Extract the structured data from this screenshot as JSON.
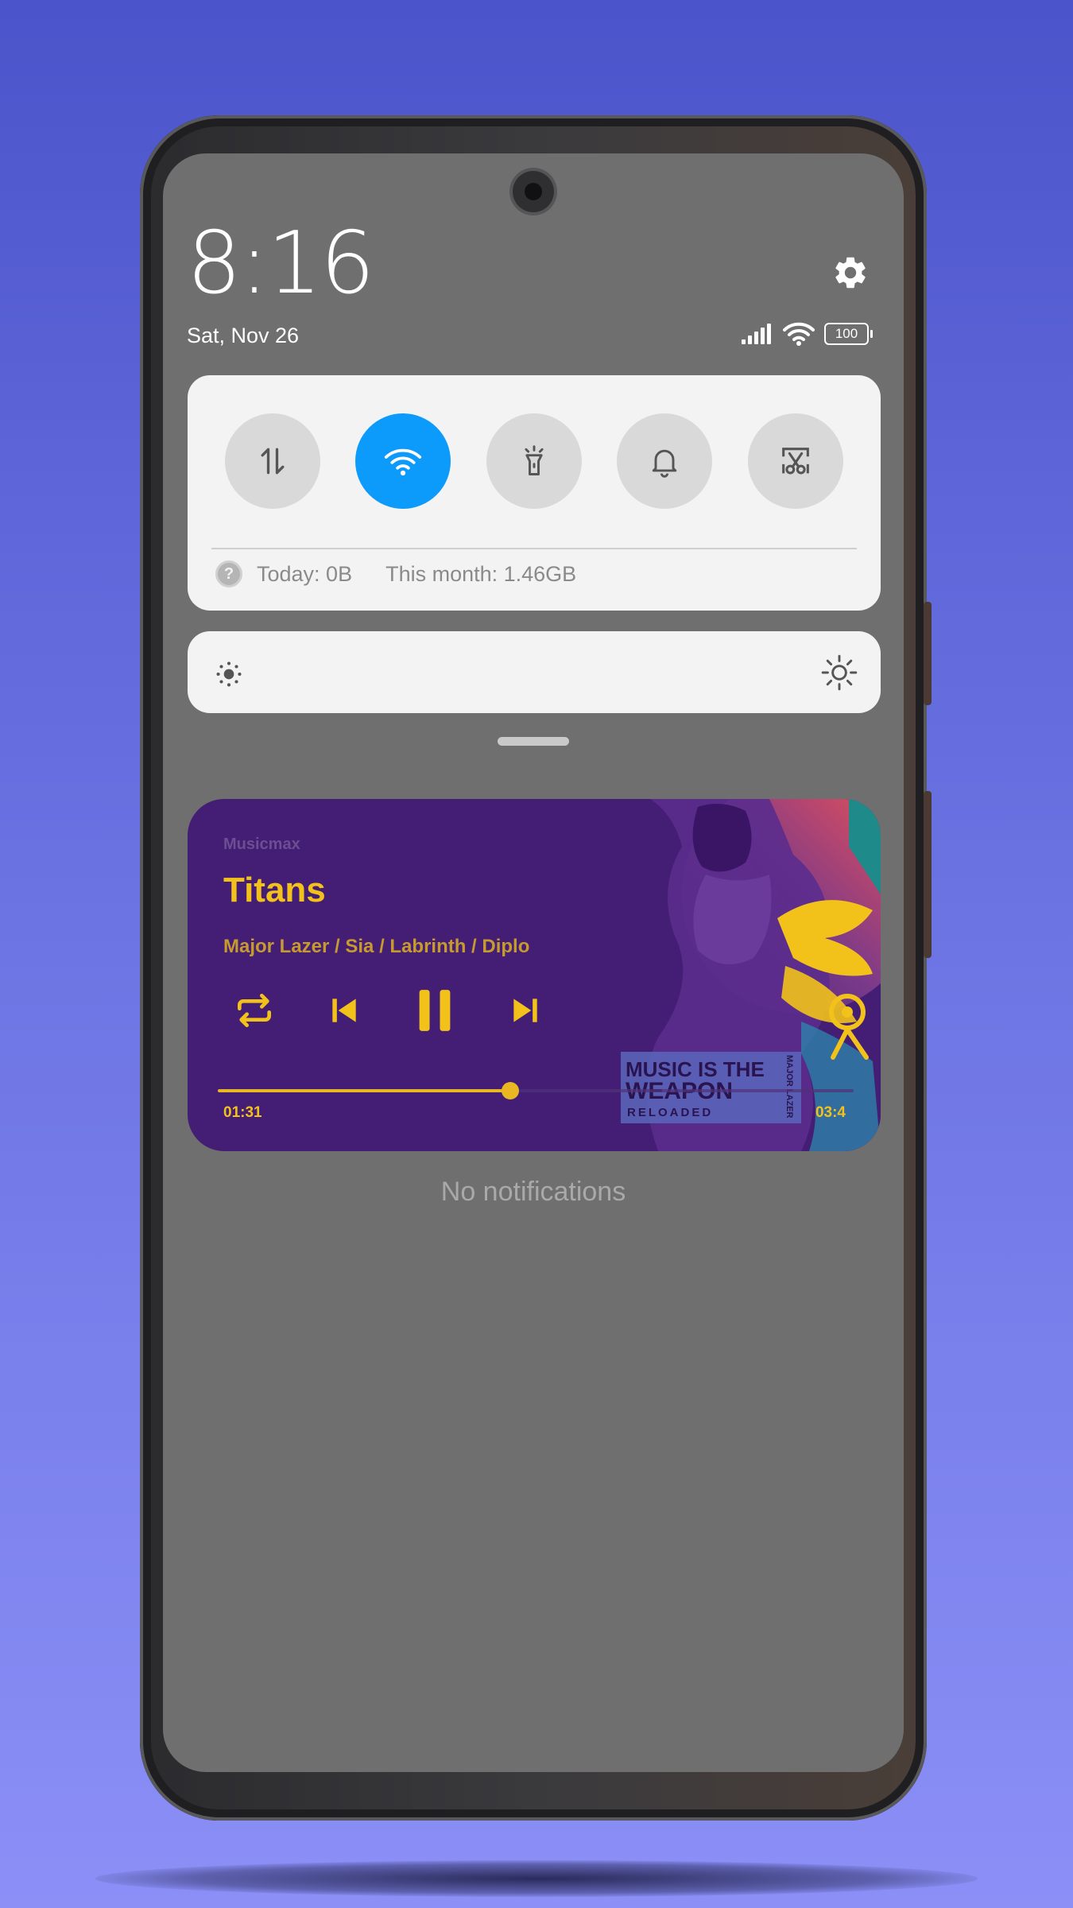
{
  "status_bar": {
    "time": "8:16",
    "date": "Sat, Nov 26",
    "battery_level": "100",
    "signal_icon": "cellular-signal-icon",
    "wifi_icon": "wifi-icon"
  },
  "quick_settings": {
    "tiles": [
      {
        "name": "mobile-data",
        "icon": "mobile-data-arrows-icon",
        "active": false
      },
      {
        "name": "wifi",
        "icon": "wifi-icon",
        "active": true
      },
      {
        "name": "flashlight",
        "icon": "flashlight-icon",
        "active": false
      },
      {
        "name": "sound",
        "icon": "bell-icon",
        "active": false
      },
      {
        "name": "screenshot",
        "icon": "scissors-screenshot-icon",
        "active": false
      }
    ],
    "data_usage": {
      "today": "Today: 0B",
      "month": "This month: 1.46GB"
    },
    "accent_color": "#0d9bfb"
  },
  "media": {
    "app": "Musicmax",
    "title": "Titans",
    "artist": "Major Lazer / Sia / Labrinth / Diplo",
    "elapsed": "01:31",
    "duration": "03:4",
    "progress": 0.46,
    "album_art_text": [
      "MUSIC IS THE",
      "WEAPON",
      "RELOADED",
      "MAJOR LAZER"
    ],
    "accent_color": "#f2c21b",
    "card_color": "#431e74"
  },
  "notifications": {
    "empty_text": "No notifications"
  }
}
